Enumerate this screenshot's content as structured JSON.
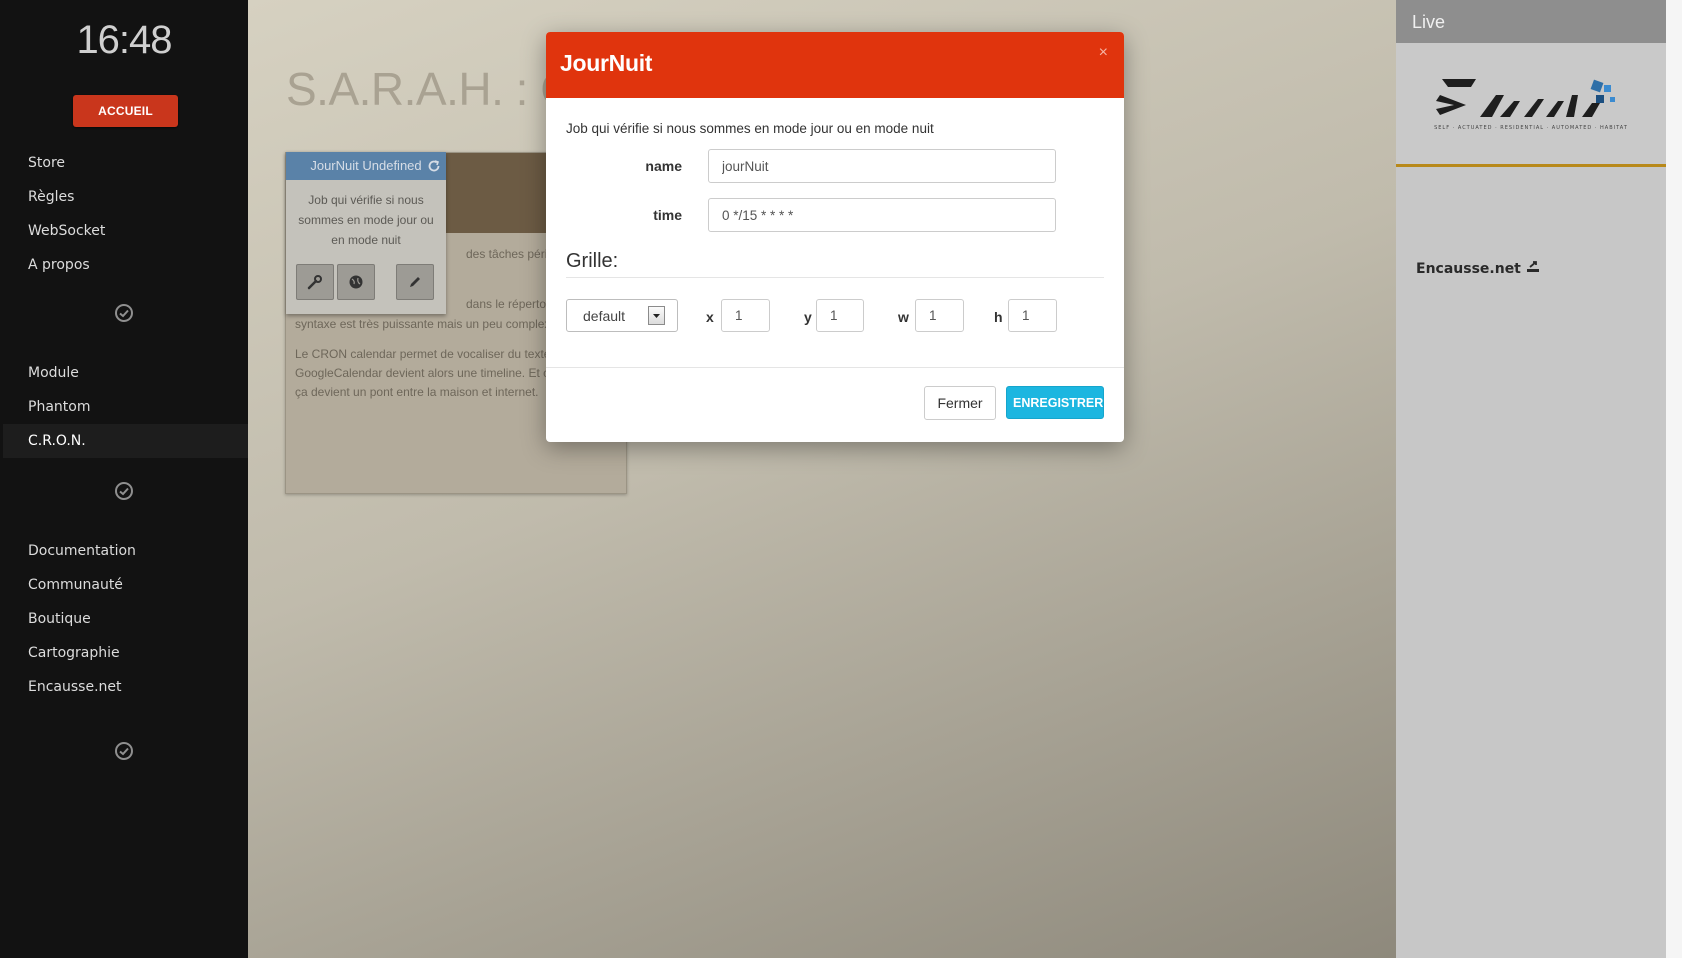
{
  "sidebar": {
    "clock": "16:48",
    "home_label": "ACCUEIL",
    "group1": [
      "Store",
      "Règles",
      "WebSocket",
      "A propos"
    ],
    "group2": [
      "Module",
      "Phantom",
      "C.R.O.N."
    ],
    "group3": [
      "Documentation",
      "Communauté",
      "Boutique",
      "Cartographie",
      "Encausse.net"
    ],
    "active_item": "C.R.O.N."
  },
  "main": {
    "page_title": "S.A.R.A.H. : C.R.O.",
    "card_lines": [
      "des tâches périodiques",
      "dans le répertoire  /",
      "syntaxe est très puissante mais un peu complexe.",
      "Le CRON calendar permet de vocaliser du texte à des mo",
      "GoogleCalendar devient alors une timeline. Et couplé à",
      "ça devient un pont entre la maison et internet."
    ],
    "tile": {
      "title": "JourNuit Undefined",
      "description": "Job qui vérifie si nous sommes en mode jour ou en mode nuit"
    }
  },
  "right_panel": {
    "live_label": "Live",
    "logo_tagline": "SELF · ACTUATED · RESIDENTIAL · AUTOMATED · HABITAT",
    "link_label": "Encausse.net"
  },
  "modal": {
    "title": "JourNuit",
    "close_glyph": "×",
    "description": "Job qui vérifie si nous sommes en mode jour ou en mode nuit",
    "fields": {
      "name_label": "name",
      "name_value": "jourNuit",
      "time_label": "time",
      "time_value": "0 */15 * * * *"
    },
    "grid": {
      "title": "Grille:",
      "select_value": "default",
      "x_label": "x",
      "x_value": "1",
      "y_label": "y",
      "y_value": "1",
      "w_label": "w",
      "w_value": "1",
      "h_label": "h",
      "h_value": "1"
    },
    "buttons": {
      "close": "Fermer",
      "save": "ENREGISTRER"
    }
  },
  "colors": {
    "modal_header": "#e0340d",
    "save_button": "#1cb6e0",
    "home_button": "#c9361c",
    "sidebar_bg": "#121212",
    "tile_header": "#5a82a8"
  }
}
